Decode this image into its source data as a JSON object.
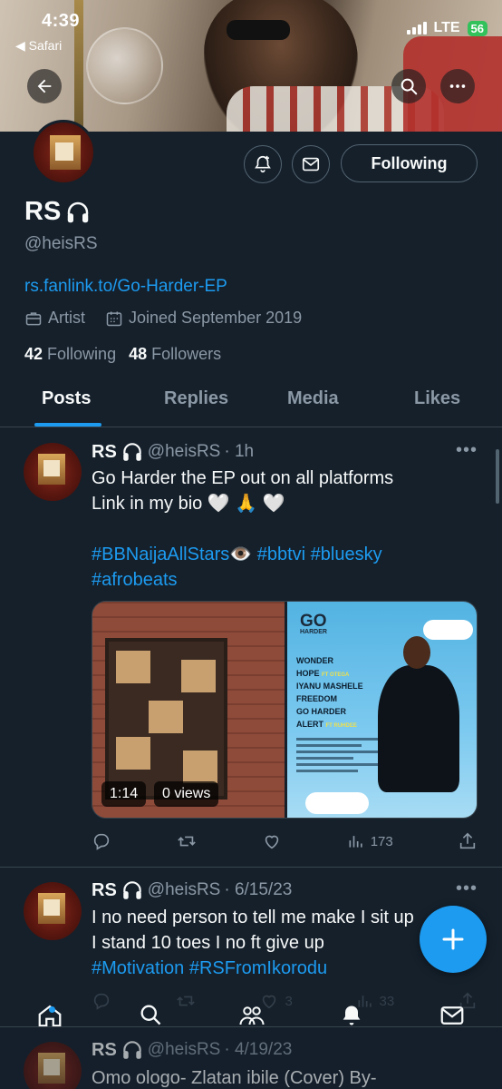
{
  "status_bar": {
    "time": "4:39",
    "back_app": "◀ Safari",
    "network": "LTE",
    "battery": "56"
  },
  "profile": {
    "name": "RS",
    "handle": "@heisRS",
    "link": "rs.fanlink.to/Go-Harder-EP",
    "category": "Artist",
    "joined": "Joined September 2019",
    "following_count": "42",
    "following_label": "Following",
    "followers_count": "48",
    "followers_label": "Followers",
    "follow_button": "Following"
  },
  "tabs": [
    {
      "label": "Posts",
      "active": true
    },
    {
      "label": "Replies",
      "active": false
    },
    {
      "label": "Media",
      "active": false
    },
    {
      "label": "Likes",
      "active": false
    }
  ],
  "posts": [
    {
      "name": "RS",
      "handle": "@heisRS",
      "time": "· 1h",
      "text_line1": "Go Harder the EP out on all platforms",
      "text_line2": "Link in my bio 🤍 🙏 🤍",
      "hashtags_line1": "#BBNaijaAllStars👁️ #bbtvi #bluesky",
      "hashtags_line2": "#afrobeats",
      "media": {
        "video_duration": "1:14",
        "video_views": "0 views",
        "cover_title_1": "GO",
        "cover_title_2": "HARDER",
        "tracks": [
          "WONDER",
          "HOPE",
          "IYANU MASHELE",
          "FREEDOM",
          "GO HARDER",
          "ALERT"
        ],
        "feat_hope": "FT OTEGA",
        "feat_alert": "FT RUHDEE"
      },
      "views": "173"
    },
    {
      "name": "RS",
      "handle": "@heisRS",
      "time": "· 6/15/23",
      "text_line1": "I no need person to tell me make I sit up",
      "text_line2": "I stand 10 toes I no ft give up",
      "hashtags_line1": "#Motivation #RSFromIkorodu",
      "likes": "3",
      "views": "33"
    },
    {
      "name": "RS",
      "handle": "@heisRS",
      "time": "· 4/19/23",
      "text_line1": "Omo ologo- Zlatan ibile (Cover) By-"
    }
  ],
  "colors": {
    "accent": "#1d9bf0",
    "background": "#15202b",
    "muted": "#8b98a5",
    "divider": "#38444d"
  },
  "icons": [
    "back-arrow-icon",
    "search-icon",
    "more-icon",
    "notification-add-icon",
    "mail-icon",
    "headphones-icon",
    "briefcase-icon",
    "calendar-icon",
    "reply-icon",
    "retweet-icon",
    "like-icon",
    "views-icon",
    "share-icon",
    "compose-plus-icon",
    "home-icon",
    "communities-icon",
    "notifications-icon",
    "messages-icon"
  ]
}
